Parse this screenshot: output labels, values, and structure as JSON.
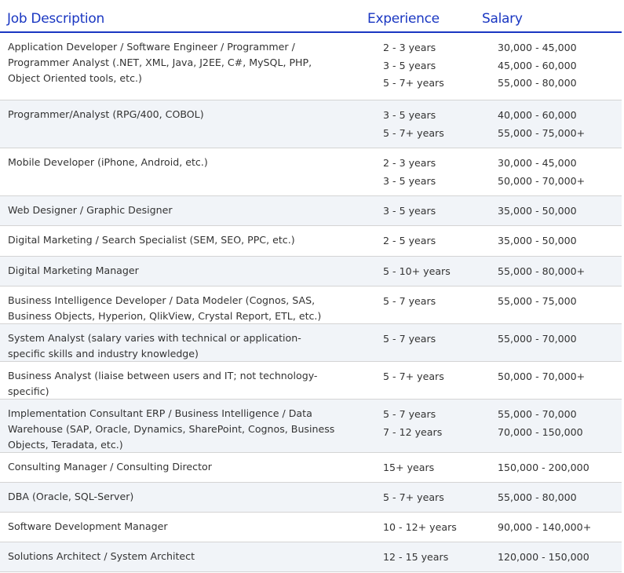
{
  "header": {
    "job": "Job Description",
    "experience": "Experience",
    "salary": "Salary"
  },
  "rows": [
    {
      "job": [
        "Application Developer / Software Engineer / Programmer /",
        "Programmer Analyst (.NET, XML, Java, J2EE, C#, MySQL, PHP,",
        "Object Oriented tools, etc.)"
      ],
      "experience": [
        "2 - 3 years",
        "3 - 5 years",
        "5 - 7+ years"
      ],
      "salary": [
        "30,000 - 45,000",
        "45,000 - 60,000",
        "55,000 - 80,000"
      ]
    },
    {
      "job": [
        "Programmer/Analyst (RPG/400, COBOL)"
      ],
      "experience": [
        "3 - 5 years",
        "5 - 7+ years"
      ],
      "salary": [
        "40,000 - 60,000",
        "55,000 - 75,000+"
      ]
    },
    {
      "job": [
        "Mobile Developer (iPhone, Android, etc.)"
      ],
      "experience": [
        "2 - 3 years",
        "3 - 5 years"
      ],
      "salary": [
        "30,000 - 45,000",
        "50,000 - 70,000+"
      ]
    },
    {
      "job": [
        "Web Designer / Graphic Designer"
      ],
      "experience": [
        "3 - 5 years"
      ],
      "salary": [
        "35,000 - 50,000"
      ]
    },
    {
      "job": [
        "Digital Marketing / Search Specialist (SEM, SEO, PPC, etc.)"
      ],
      "experience": [
        "2 - 5 years"
      ],
      "salary": [
        "35,000 - 50,000"
      ]
    },
    {
      "job": [
        "Digital Marketing Manager"
      ],
      "experience": [
        "5 - 10+ years"
      ],
      "salary": [
        "55,000 - 80,000+"
      ]
    },
    {
      "job": [
        "Business Intelligence Developer / Data Modeler (Cognos, SAS,",
        "Business Objects, Hyperion, QlikView, Crystal Report, ETL, etc.)"
      ],
      "experience": [
        "5 - 7 years"
      ],
      "salary": [
        "55,000 - 75,000"
      ]
    },
    {
      "job": [
        "System Analyst (salary varies with technical or application-",
        "specific skills and industry knowledge)"
      ],
      "experience": [
        "5 - 7 years"
      ],
      "salary": [
        "55,000 - 70,000"
      ]
    },
    {
      "job": [
        "Business Analyst (liaise between users and IT; not technology-",
        "specific)"
      ],
      "experience": [
        "5 - 7+ years"
      ],
      "salary": [
        "50,000 - 70,000+"
      ]
    },
    {
      "job": [
        "Implementation Consultant ERP / Business Intelligence / Data",
        "Warehouse (SAP, Oracle, Dynamics, SharePoint, Cognos, Business",
        "Objects, Teradata, etc.)"
      ],
      "experience": [
        "5 - 7 years",
        "7 - 12 years"
      ],
      "salary": [
        "55,000 - 70,000",
        "70,000 - 150,000"
      ]
    },
    {
      "job": [
        "Consulting Manager / Consulting Director"
      ],
      "experience": [
        "15+ years"
      ],
      "salary": [
        "150,000 - 200,000"
      ]
    },
    {
      "job": [
        "DBA (Oracle, SQL-Server)"
      ],
      "experience": [
        "5 - 7+ years"
      ],
      "salary": [
        "55,000 - 80,000"
      ]
    },
    {
      "job": [
        "Software Development Manager"
      ],
      "experience": [
        "10 - 12+ years"
      ],
      "salary": [
        "90,000 - 140,000+"
      ]
    },
    {
      "job": [
        "Solutions Architect / System Architect"
      ],
      "experience": [
        "12 - 15 years"
      ],
      "salary": [
        "120,000 - 150,000"
      ]
    }
  ]
}
